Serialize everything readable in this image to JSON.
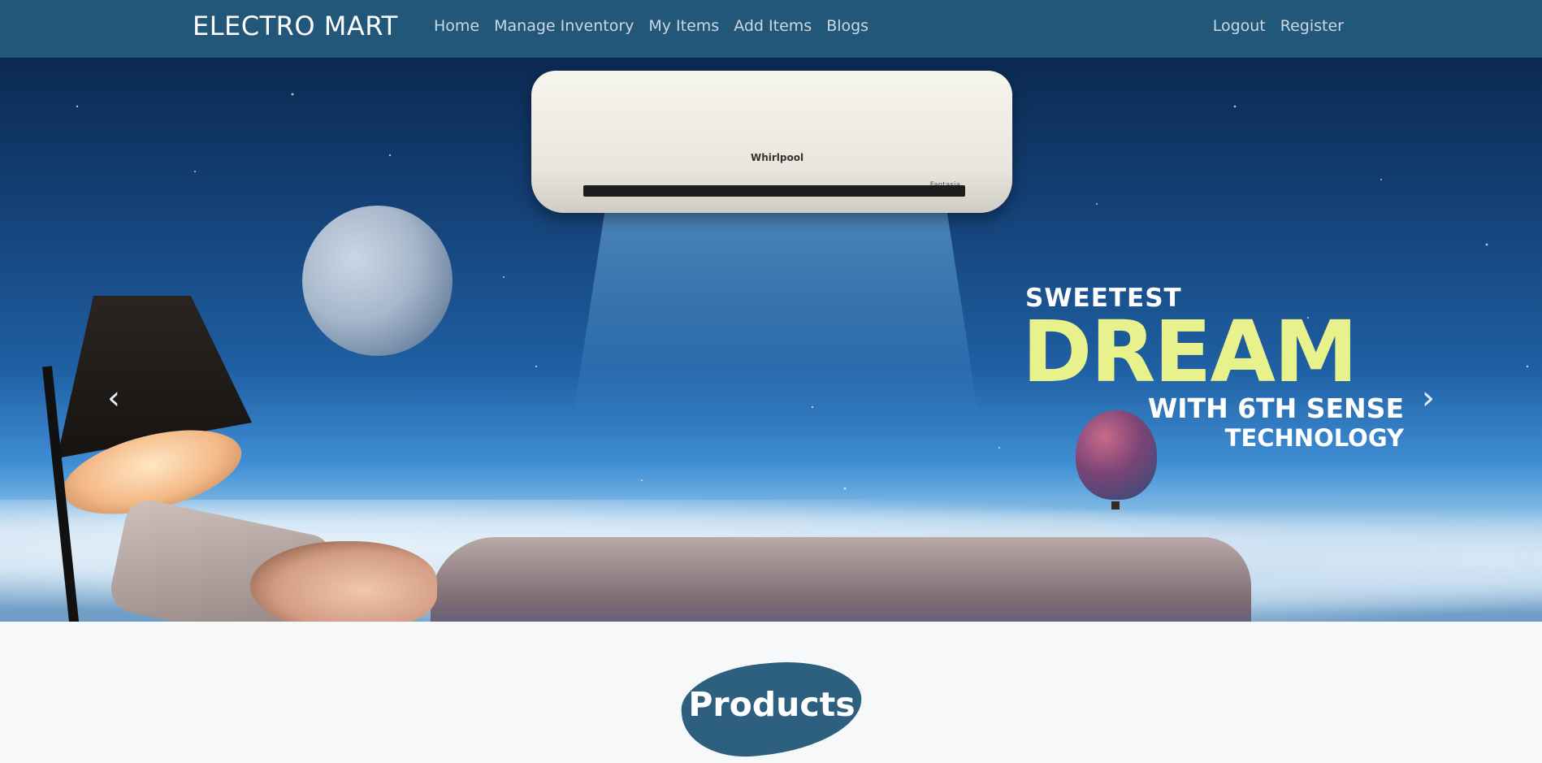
{
  "navbar": {
    "brand": "ELECTRO MART",
    "links": [
      "Home",
      "Manage Inventory",
      "My Items",
      "Add Items",
      "Blogs"
    ],
    "right_links": [
      "Logout",
      "Register"
    ],
    "bg_color": "#22577a"
  },
  "carousel": {
    "slide": {
      "headline_top": "SWEETEST",
      "headline_main": "DREAM",
      "headline_sub": "WITH 6TH SENSE",
      "headline_tail": "TECHNOLOGY",
      "ac_brand": "Whirlpool",
      "ac_model": "Fantasia"
    },
    "prev_icon": "chevron-left-icon",
    "next_icon": "chevron-right-icon",
    "prev_glyph": "‹",
    "next_glyph": "›",
    "indicator_count": 4,
    "active_index": 0
  },
  "products": {
    "title": "Products",
    "badge_color": "#2d5f7e"
  }
}
